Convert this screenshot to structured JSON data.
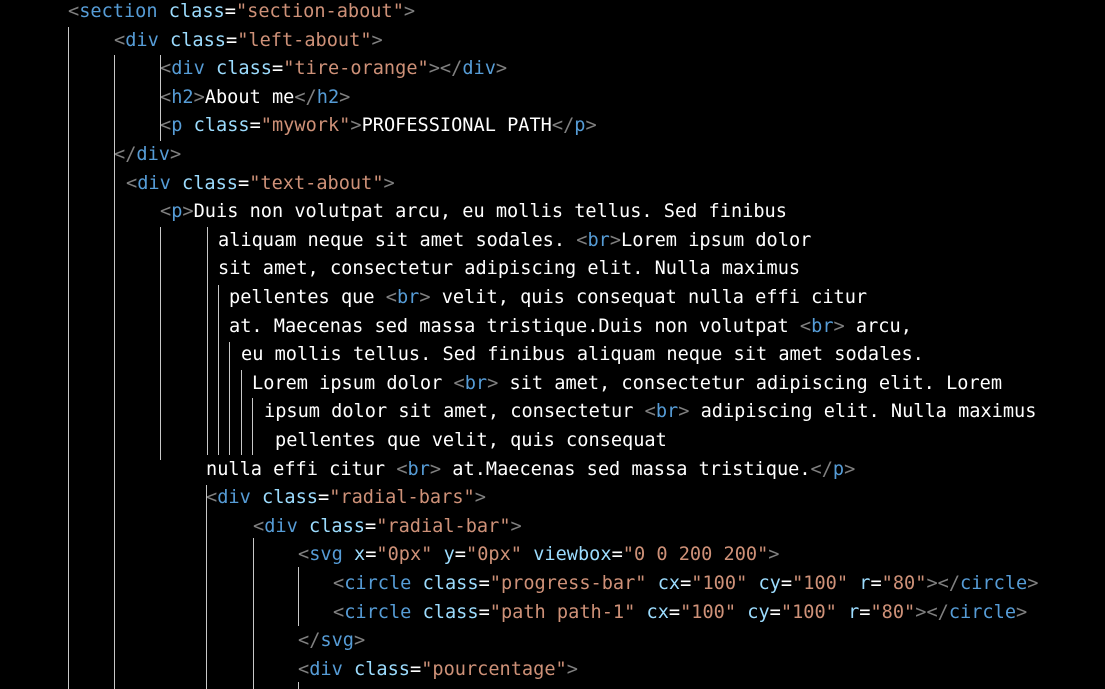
{
  "editor": {
    "language": "html",
    "colors": {
      "background": "#000000",
      "punctuation": "#808080",
      "tag": "#569cd6",
      "attribute": "#9cdcfe",
      "string": "#ce9178",
      "text": "#ffffff",
      "indent_guide": "#c8c8c8"
    },
    "lines": [
      {
        "tokens": [
          {
            "t": "punct",
            "v": "<"
          },
          {
            "t": "tag",
            "v": "section"
          },
          {
            "t": "text",
            "v": " "
          },
          {
            "t": "attr",
            "v": "class"
          },
          {
            "t": "text",
            "v": "="
          },
          {
            "t": "str",
            "v": "\"section-about\""
          },
          {
            "t": "punct",
            "v": ">"
          }
        ]
      },
      {
        "tokens": [
          {
            "t": "punct",
            "v": "<"
          },
          {
            "t": "tag",
            "v": "div"
          },
          {
            "t": "text",
            "v": " "
          },
          {
            "t": "attr",
            "v": "class"
          },
          {
            "t": "text",
            "v": "="
          },
          {
            "t": "str",
            "v": "\"left-about\""
          },
          {
            "t": "punct",
            "v": ">"
          }
        ]
      },
      {
        "tokens": [
          {
            "t": "punct",
            "v": "<"
          },
          {
            "t": "tag",
            "v": "div"
          },
          {
            "t": "text",
            "v": " "
          },
          {
            "t": "attr",
            "v": "class"
          },
          {
            "t": "text",
            "v": "="
          },
          {
            "t": "str",
            "v": "\"tire-orange\""
          },
          {
            "t": "punct",
            "v": "></"
          },
          {
            "t": "tag",
            "v": "div"
          },
          {
            "t": "punct",
            "v": ">"
          }
        ]
      },
      {
        "tokens": [
          {
            "t": "punct",
            "v": "<"
          },
          {
            "t": "tag",
            "v": "h2"
          },
          {
            "t": "punct",
            "v": ">"
          },
          {
            "t": "text",
            "v": "About me"
          },
          {
            "t": "punct",
            "v": "</"
          },
          {
            "t": "tag",
            "v": "h2"
          },
          {
            "t": "punct",
            "v": ">"
          }
        ]
      },
      {
        "tokens": [
          {
            "t": "punct",
            "v": "<"
          },
          {
            "t": "tag",
            "v": "p"
          },
          {
            "t": "text",
            "v": " "
          },
          {
            "t": "attr",
            "v": "class"
          },
          {
            "t": "text",
            "v": "="
          },
          {
            "t": "str",
            "v": "\"mywork\""
          },
          {
            "t": "punct",
            "v": ">"
          },
          {
            "t": "text",
            "v": "PROFESSIONAL PATH"
          },
          {
            "t": "punct",
            "v": "</"
          },
          {
            "t": "tag",
            "v": "p"
          },
          {
            "t": "punct",
            "v": ">"
          }
        ]
      },
      {
        "tokens": [
          {
            "t": "punct",
            "v": "</"
          },
          {
            "t": "tag",
            "v": "div"
          },
          {
            "t": "punct",
            "v": ">"
          }
        ]
      },
      {
        "tokens": [
          {
            "t": "punct",
            "v": "<"
          },
          {
            "t": "tag",
            "v": "div"
          },
          {
            "t": "text",
            "v": " "
          },
          {
            "t": "attr",
            "v": "class"
          },
          {
            "t": "text",
            "v": "="
          },
          {
            "t": "str",
            "v": "\"text-about\""
          },
          {
            "t": "punct",
            "v": ">"
          }
        ]
      },
      {
        "tokens": [
          {
            "t": "punct",
            "v": "<"
          },
          {
            "t": "tag",
            "v": "p"
          },
          {
            "t": "punct",
            "v": ">"
          },
          {
            "t": "text",
            "v": "Duis non volutpat arcu, eu mollis tellus. Sed finibus"
          }
        ]
      },
      {
        "tokens": [
          {
            "t": "text",
            "v": "aliquam neque sit amet sodales. "
          },
          {
            "t": "punct",
            "v": "<"
          },
          {
            "t": "tag",
            "v": "br"
          },
          {
            "t": "punct",
            "v": ">"
          },
          {
            "t": "text",
            "v": "Lorem ipsum dolor"
          }
        ]
      },
      {
        "tokens": [
          {
            "t": "text",
            "v": "sit amet, consectetur adipiscing elit. Nulla maximus"
          }
        ]
      },
      {
        "tokens": [
          {
            "t": "text",
            "v": "pellentes que "
          },
          {
            "t": "punct",
            "v": "<"
          },
          {
            "t": "tag",
            "v": "br"
          },
          {
            "t": "punct",
            "v": ">"
          },
          {
            "t": "text",
            "v": " velit, quis consequat nulla effi citur"
          }
        ]
      },
      {
        "tokens": [
          {
            "t": "text",
            "v": "at. Maecenas sed massa tristique.Duis non volutpat "
          },
          {
            "t": "punct",
            "v": "<"
          },
          {
            "t": "tag",
            "v": "br"
          },
          {
            "t": "punct",
            "v": ">"
          },
          {
            "t": "text",
            "v": " arcu,"
          }
        ]
      },
      {
        "tokens": [
          {
            "t": "text",
            "v": "eu mollis tellus. Sed finibus aliquam neque sit amet sodales."
          }
        ]
      },
      {
        "tokens": [
          {
            "t": "text",
            "v": "Lorem ipsum dolor "
          },
          {
            "t": "punct",
            "v": "<"
          },
          {
            "t": "tag",
            "v": "br"
          },
          {
            "t": "punct",
            "v": ">"
          },
          {
            "t": "text",
            "v": " sit amet, consectetur adipiscing elit. Lorem"
          }
        ]
      },
      {
        "tokens": [
          {
            "t": "text",
            "v": "ipsum dolor sit amet, consectetur "
          },
          {
            "t": "punct",
            "v": "<"
          },
          {
            "t": "tag",
            "v": "br"
          },
          {
            "t": "punct",
            "v": ">"
          },
          {
            "t": "text",
            "v": " adipiscing elit. Nulla maximus"
          }
        ]
      },
      {
        "tokens": [
          {
            "t": "text",
            "v": "pellentes que velit, quis consequat"
          }
        ]
      },
      {
        "tokens": [
          {
            "t": "text",
            "v": "nulla effi citur "
          },
          {
            "t": "punct",
            "v": "<"
          },
          {
            "t": "tag",
            "v": "br"
          },
          {
            "t": "punct",
            "v": ">"
          },
          {
            "t": "text",
            "v": " at.Maecenas sed massa tristique."
          },
          {
            "t": "punct",
            "v": "</"
          },
          {
            "t": "tag",
            "v": "p"
          },
          {
            "t": "punct",
            "v": ">"
          }
        ]
      },
      {
        "tokens": [
          {
            "t": "punct",
            "v": "<"
          },
          {
            "t": "tag",
            "v": "div"
          },
          {
            "t": "text",
            "v": " "
          },
          {
            "t": "attr",
            "v": "class"
          },
          {
            "t": "text",
            "v": "="
          },
          {
            "t": "str",
            "v": "\"radial-bars\""
          },
          {
            "t": "punct",
            "v": ">"
          }
        ]
      },
      {
        "tokens": [
          {
            "t": "punct",
            "v": "<"
          },
          {
            "t": "tag",
            "v": "div"
          },
          {
            "t": "text",
            "v": " "
          },
          {
            "t": "attr",
            "v": "class"
          },
          {
            "t": "text",
            "v": "="
          },
          {
            "t": "str",
            "v": "\"radial-bar\""
          },
          {
            "t": "punct",
            "v": ">"
          }
        ]
      },
      {
        "tokens": [
          {
            "t": "punct",
            "v": "<"
          },
          {
            "t": "tag",
            "v": "svg"
          },
          {
            "t": "text",
            "v": " "
          },
          {
            "t": "attr",
            "v": "x"
          },
          {
            "t": "text",
            "v": "="
          },
          {
            "t": "str",
            "v": "\"0px\""
          },
          {
            "t": "text",
            "v": " "
          },
          {
            "t": "attr",
            "v": "y"
          },
          {
            "t": "text",
            "v": "="
          },
          {
            "t": "str",
            "v": "\"0px\""
          },
          {
            "t": "text",
            "v": " "
          },
          {
            "t": "attr",
            "v": "viewbox"
          },
          {
            "t": "text",
            "v": "="
          },
          {
            "t": "str",
            "v": "\"0 0 200 200\""
          },
          {
            "t": "punct",
            "v": ">"
          }
        ]
      },
      {
        "tokens": [
          {
            "t": "punct",
            "v": "<"
          },
          {
            "t": "tag",
            "v": "circle"
          },
          {
            "t": "text",
            "v": " "
          },
          {
            "t": "attr",
            "v": "class"
          },
          {
            "t": "text",
            "v": "="
          },
          {
            "t": "str",
            "v": "\"progress-bar\""
          },
          {
            "t": "text",
            "v": " "
          },
          {
            "t": "attr",
            "v": "cx"
          },
          {
            "t": "text",
            "v": "="
          },
          {
            "t": "str",
            "v": "\"100\""
          },
          {
            "t": "text",
            "v": " "
          },
          {
            "t": "attr",
            "v": "cy"
          },
          {
            "t": "text",
            "v": "="
          },
          {
            "t": "str",
            "v": "\"100\""
          },
          {
            "t": "text",
            "v": " "
          },
          {
            "t": "attr",
            "v": "r"
          },
          {
            "t": "text",
            "v": "="
          },
          {
            "t": "str",
            "v": "\"80\""
          },
          {
            "t": "punct",
            "v": "></"
          },
          {
            "t": "tag",
            "v": "circle"
          },
          {
            "t": "punct",
            "v": ">"
          }
        ]
      },
      {
        "tokens": [
          {
            "t": "punct",
            "v": "<"
          },
          {
            "t": "tag",
            "v": "circle"
          },
          {
            "t": "text",
            "v": " "
          },
          {
            "t": "attr",
            "v": "class"
          },
          {
            "t": "text",
            "v": "="
          },
          {
            "t": "str",
            "v": "\"path path-1\""
          },
          {
            "t": "text",
            "v": " "
          },
          {
            "t": "attr",
            "v": "cx"
          },
          {
            "t": "text",
            "v": "="
          },
          {
            "t": "str",
            "v": "\"100\""
          },
          {
            "t": "text",
            "v": " "
          },
          {
            "t": "attr",
            "v": "cy"
          },
          {
            "t": "text",
            "v": "="
          },
          {
            "t": "str",
            "v": "\"100\""
          },
          {
            "t": "text",
            "v": " "
          },
          {
            "t": "attr",
            "v": "r"
          },
          {
            "t": "text",
            "v": "="
          },
          {
            "t": "str",
            "v": "\"80\""
          },
          {
            "t": "punct",
            "v": "></"
          },
          {
            "t": "tag",
            "v": "circle"
          },
          {
            "t": "punct",
            "v": ">"
          }
        ]
      },
      {
        "tokens": [
          {
            "t": "punct",
            "v": "</"
          },
          {
            "t": "tag",
            "v": "svg"
          },
          {
            "t": "punct",
            "v": ">"
          }
        ]
      },
      {
        "tokens": [
          {
            "t": "punct",
            "v": "<"
          },
          {
            "t": "tag",
            "v": "div"
          },
          {
            "t": "text",
            "v": " "
          },
          {
            "t": "attr",
            "v": "class"
          },
          {
            "t": "text",
            "v": "="
          },
          {
            "t": "str",
            "v": "\"pourcentage\""
          },
          {
            "t": "punct",
            "v": ">"
          }
        ]
      }
    ]
  }
}
